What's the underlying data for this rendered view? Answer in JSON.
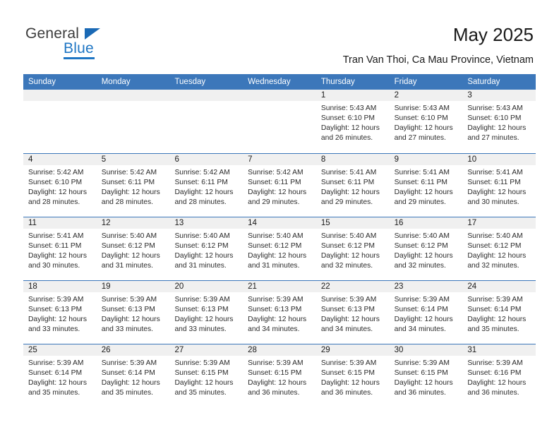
{
  "brand": {
    "name_part1": "General",
    "name_part2": "Blue",
    "logo_icon": "triangle-logo-icon"
  },
  "header": {
    "title": "May 2025",
    "subtitle": "Tran Van Thoi, Ca Mau Province, Vietnam"
  },
  "weekdays": [
    "Sunday",
    "Monday",
    "Tuesday",
    "Wednesday",
    "Thursday",
    "Friday",
    "Saturday"
  ],
  "colors": {
    "header_blue": "#3c77ba",
    "brand_blue": "#1f76c4",
    "day_band": "#f0f0f0",
    "text": "#1a1a1a"
  },
  "weeks": [
    [
      {
        "day": "",
        "empty": true
      },
      {
        "day": "",
        "empty": true
      },
      {
        "day": "",
        "empty": true
      },
      {
        "day": "",
        "empty": true
      },
      {
        "day": "1",
        "sunrise": "Sunrise: 5:43 AM",
        "sunset": "Sunset: 6:10 PM",
        "daylight": "Daylight: 12 hours and 26 minutes."
      },
      {
        "day": "2",
        "sunrise": "Sunrise: 5:43 AM",
        "sunset": "Sunset: 6:10 PM",
        "daylight": "Daylight: 12 hours and 27 minutes."
      },
      {
        "day": "3",
        "sunrise": "Sunrise: 5:43 AM",
        "sunset": "Sunset: 6:10 PM",
        "daylight": "Daylight: 12 hours and 27 minutes."
      }
    ],
    [
      {
        "day": "4",
        "sunrise": "Sunrise: 5:42 AM",
        "sunset": "Sunset: 6:10 PM",
        "daylight": "Daylight: 12 hours and 28 minutes."
      },
      {
        "day": "5",
        "sunrise": "Sunrise: 5:42 AM",
        "sunset": "Sunset: 6:11 PM",
        "daylight": "Daylight: 12 hours and 28 minutes."
      },
      {
        "day": "6",
        "sunrise": "Sunrise: 5:42 AM",
        "sunset": "Sunset: 6:11 PM",
        "daylight": "Daylight: 12 hours and 28 minutes."
      },
      {
        "day": "7",
        "sunrise": "Sunrise: 5:42 AM",
        "sunset": "Sunset: 6:11 PM",
        "daylight": "Daylight: 12 hours and 29 minutes."
      },
      {
        "day": "8",
        "sunrise": "Sunrise: 5:41 AM",
        "sunset": "Sunset: 6:11 PM",
        "daylight": "Daylight: 12 hours and 29 minutes."
      },
      {
        "day": "9",
        "sunrise": "Sunrise: 5:41 AM",
        "sunset": "Sunset: 6:11 PM",
        "daylight": "Daylight: 12 hours and 29 minutes."
      },
      {
        "day": "10",
        "sunrise": "Sunrise: 5:41 AM",
        "sunset": "Sunset: 6:11 PM",
        "daylight": "Daylight: 12 hours and 30 minutes."
      }
    ],
    [
      {
        "day": "11",
        "sunrise": "Sunrise: 5:41 AM",
        "sunset": "Sunset: 6:11 PM",
        "daylight": "Daylight: 12 hours and 30 minutes."
      },
      {
        "day": "12",
        "sunrise": "Sunrise: 5:40 AM",
        "sunset": "Sunset: 6:12 PM",
        "daylight": "Daylight: 12 hours and 31 minutes."
      },
      {
        "day": "13",
        "sunrise": "Sunrise: 5:40 AM",
        "sunset": "Sunset: 6:12 PM",
        "daylight": "Daylight: 12 hours and 31 minutes."
      },
      {
        "day": "14",
        "sunrise": "Sunrise: 5:40 AM",
        "sunset": "Sunset: 6:12 PM",
        "daylight": "Daylight: 12 hours and 31 minutes."
      },
      {
        "day": "15",
        "sunrise": "Sunrise: 5:40 AM",
        "sunset": "Sunset: 6:12 PM",
        "daylight": "Daylight: 12 hours and 32 minutes."
      },
      {
        "day": "16",
        "sunrise": "Sunrise: 5:40 AM",
        "sunset": "Sunset: 6:12 PM",
        "daylight": "Daylight: 12 hours and 32 minutes."
      },
      {
        "day": "17",
        "sunrise": "Sunrise: 5:40 AM",
        "sunset": "Sunset: 6:12 PM",
        "daylight": "Daylight: 12 hours and 32 minutes."
      }
    ],
    [
      {
        "day": "18",
        "sunrise": "Sunrise: 5:39 AM",
        "sunset": "Sunset: 6:13 PM",
        "daylight": "Daylight: 12 hours and 33 minutes."
      },
      {
        "day": "19",
        "sunrise": "Sunrise: 5:39 AM",
        "sunset": "Sunset: 6:13 PM",
        "daylight": "Daylight: 12 hours and 33 minutes."
      },
      {
        "day": "20",
        "sunrise": "Sunrise: 5:39 AM",
        "sunset": "Sunset: 6:13 PM",
        "daylight": "Daylight: 12 hours and 33 minutes."
      },
      {
        "day": "21",
        "sunrise": "Sunrise: 5:39 AM",
        "sunset": "Sunset: 6:13 PM",
        "daylight": "Daylight: 12 hours and 34 minutes."
      },
      {
        "day": "22",
        "sunrise": "Sunrise: 5:39 AM",
        "sunset": "Sunset: 6:13 PM",
        "daylight": "Daylight: 12 hours and 34 minutes."
      },
      {
        "day": "23",
        "sunrise": "Sunrise: 5:39 AM",
        "sunset": "Sunset: 6:14 PM",
        "daylight": "Daylight: 12 hours and 34 minutes."
      },
      {
        "day": "24",
        "sunrise": "Sunrise: 5:39 AM",
        "sunset": "Sunset: 6:14 PM",
        "daylight": "Daylight: 12 hours and 35 minutes."
      }
    ],
    [
      {
        "day": "25",
        "sunrise": "Sunrise: 5:39 AM",
        "sunset": "Sunset: 6:14 PM",
        "daylight": "Daylight: 12 hours and 35 minutes."
      },
      {
        "day": "26",
        "sunrise": "Sunrise: 5:39 AM",
        "sunset": "Sunset: 6:14 PM",
        "daylight": "Daylight: 12 hours and 35 minutes."
      },
      {
        "day": "27",
        "sunrise": "Sunrise: 5:39 AM",
        "sunset": "Sunset: 6:15 PM",
        "daylight": "Daylight: 12 hours and 35 minutes."
      },
      {
        "day": "28",
        "sunrise": "Sunrise: 5:39 AM",
        "sunset": "Sunset: 6:15 PM",
        "daylight": "Daylight: 12 hours and 36 minutes."
      },
      {
        "day": "29",
        "sunrise": "Sunrise: 5:39 AM",
        "sunset": "Sunset: 6:15 PM",
        "daylight": "Daylight: 12 hours and 36 minutes."
      },
      {
        "day": "30",
        "sunrise": "Sunrise: 5:39 AM",
        "sunset": "Sunset: 6:15 PM",
        "daylight": "Daylight: 12 hours and 36 minutes."
      },
      {
        "day": "31",
        "sunrise": "Sunrise: 5:39 AM",
        "sunset": "Sunset: 6:16 PM",
        "daylight": "Daylight: 12 hours and 36 minutes."
      }
    ]
  ]
}
